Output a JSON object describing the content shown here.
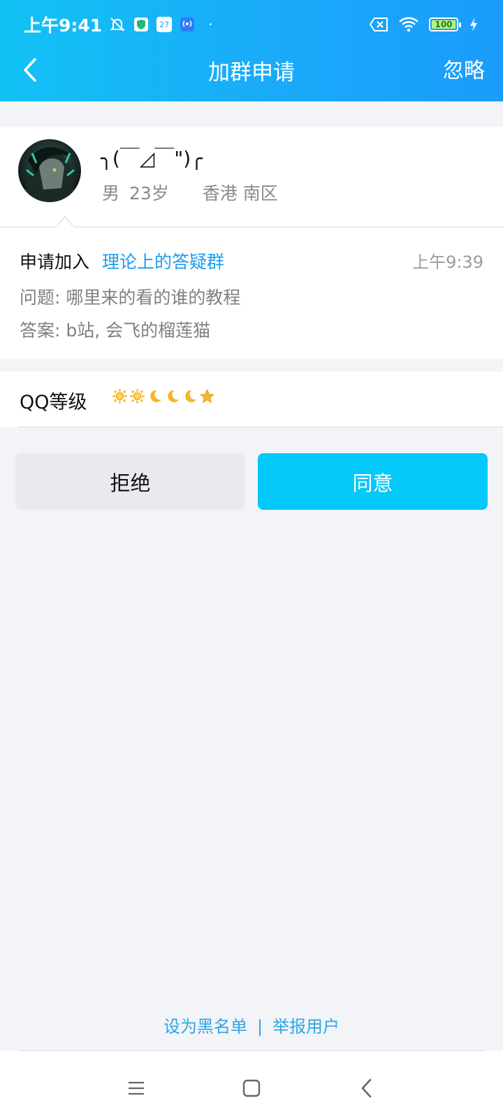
{
  "status_bar": {
    "time": "上午9:41",
    "calendar_day": "27",
    "battery": "100"
  },
  "nav": {
    "title": "加群申请",
    "ignore_label": "忽略"
  },
  "profile": {
    "nickname": "╮(￣◿￣\")╭",
    "gender": "男",
    "age": "23岁",
    "location": "香港 南区"
  },
  "request": {
    "prefix": "申请加入",
    "group_name": "理论上的答疑群",
    "time": "上午9:39",
    "question": "问题: 哪里来的看的谁的教程",
    "answer": "答案: b站, 会飞的榴莲猫"
  },
  "qq_level": {
    "label": "QQ等级",
    "icons": [
      "sun-icon",
      "sun-icon",
      "moon-icon",
      "moon-icon",
      "moon-icon",
      "star-icon"
    ]
  },
  "actions": {
    "reject_label": "拒绝",
    "agree_label": "同意"
  },
  "footer": {
    "blacklist_label": "设为黑名单",
    "separator": "|",
    "report_label": "举报用户"
  },
  "colors": {
    "header_start": "#12c2f5",
    "header_end": "#1a9cfb",
    "agree_button": "#05c8fb",
    "link": "#2da6e6"
  }
}
